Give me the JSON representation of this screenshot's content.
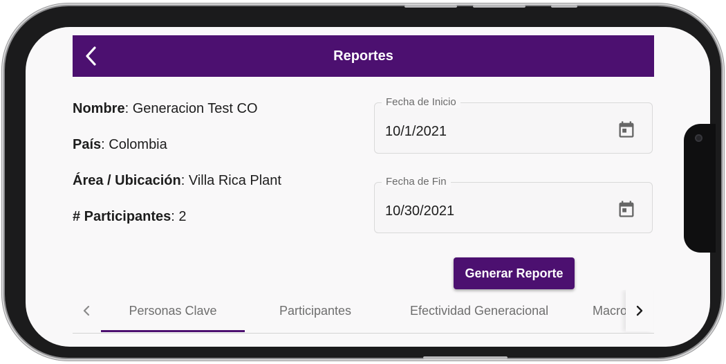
{
  "appbar": {
    "title": "Reportes",
    "back_icon": "chevron-left-icon"
  },
  "info": [
    {
      "label": "Nombre",
      "value": ": Generacion Test CO"
    },
    {
      "label": "País",
      "value": ": Colombia"
    },
    {
      "label": "Área / Ubicación",
      "value": ": Villa Rica Plant"
    },
    {
      "label": "# Participantes",
      "value": ": 2"
    }
  ],
  "start_date": {
    "label": "Fecha de Inicio",
    "value": "10/1/2021",
    "icon": "calendar-icon"
  },
  "end_date": {
    "label": "Fecha de Fin",
    "value": "10/30/2021",
    "icon": "calendar-icon"
  },
  "generate_button": {
    "label": "Generar Reporte"
  },
  "tabs": [
    {
      "label": "Personas Clave",
      "active": true
    },
    {
      "label": "Participantes",
      "active": false
    },
    {
      "label": "Efectividad Generacional",
      "active": false
    },
    {
      "label": "Macro",
      "active": false
    }
  ],
  "colors": {
    "primary": "#4c1070",
    "background": "#f9f8f9",
    "text": "#1d1d1d",
    "tab_text": "#6e6e6e"
  }
}
